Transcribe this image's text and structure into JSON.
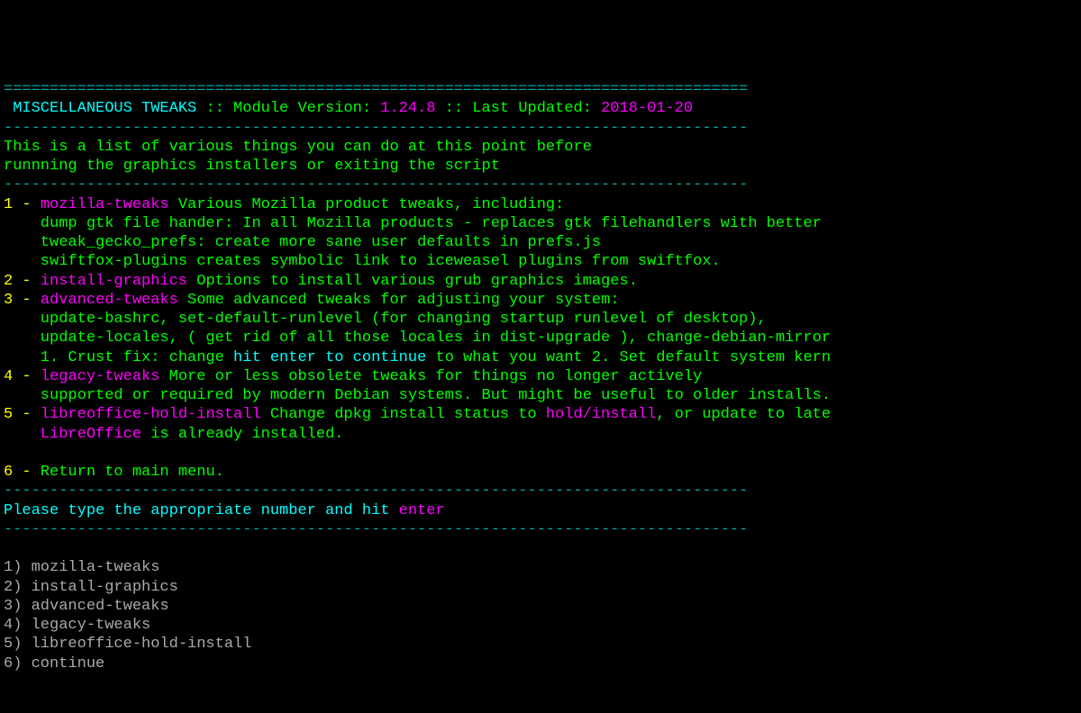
{
  "header": {
    "border": "=================================================================================",
    "title": " MISCELLANEOUS TWEAKS ",
    "sep": ":: ",
    "version_label": "Module Version: ",
    "version": "1.24.8 ",
    "updated_label": "Last Updated: ",
    "updated": "2018-01-20"
  },
  "divider": "---------------------------------------------------------------------------------",
  "intro1": "This is a list of various things you can do at this point before",
  "intro2": "runnning the graphics installers or exiting the script",
  "items": {
    "n1": "1 - ",
    "k1": "mozilla-tweaks ",
    "d1": "Various Mozilla product tweaks, including:",
    "d1a": "    dump gtk file hander: In all Mozilla products - replaces gtk filehandlers with better",
    "d1b": "    tweak_gecko_prefs: create more sane user defaults in prefs.js",
    "d1c": "    swiftfox-plugins creates symbolic link to iceweasel plugins from swiftfox.",
    "n2": "2 - ",
    "k2": "install-graphics ",
    "d2": "Options to install various grub graphics images.",
    "n3": "3 - ",
    "k3": "advanced-tweaks ",
    "d3": "Some advanced tweaks for adjusting your system:",
    "d3a": "    update-bashrc, set-default-runlevel (for changing startup runlevel of desktop),",
    "d3b": "    update-locales, ( get rid of all those locales in dist-upgrade ), change-debian-mirror",
    "d3c_pre": "    1. Crust fix: change ",
    "d3c_hl": "hit enter to continue",
    "d3c_post": " to what you want 2. Set default system kern",
    "n4": "4 - ",
    "k4": "legacy-tweaks ",
    "d4": "More or less obsolete tweaks for things no longer actively",
    "d4a": "    supported or required by modern Debian systems. But might be useful to older installs.",
    "n5": "5 - ",
    "k5": "libreoffice-hold-install ",
    "d5a": "Change dpkg install status to ",
    "d5b": "hold/install",
    "d5c": ", or update to late",
    "d5d_pre": "    ",
    "d5d_hl": "LibreOffice",
    "d5d_post": " is already installed.",
    "n6": "6 - ",
    "d6": "Return to main menu."
  },
  "prompt": {
    "pre": "Please type the appropriate number and hit ",
    "key": "enter"
  },
  "list": {
    "o1": "1) mozilla-tweaks",
    "o2": "2) install-graphics",
    "o3": "3) advanced-tweaks",
    "o4": "4) legacy-tweaks",
    "o5": "5) libreoffice-hold-install",
    "o6": "6) continue"
  }
}
